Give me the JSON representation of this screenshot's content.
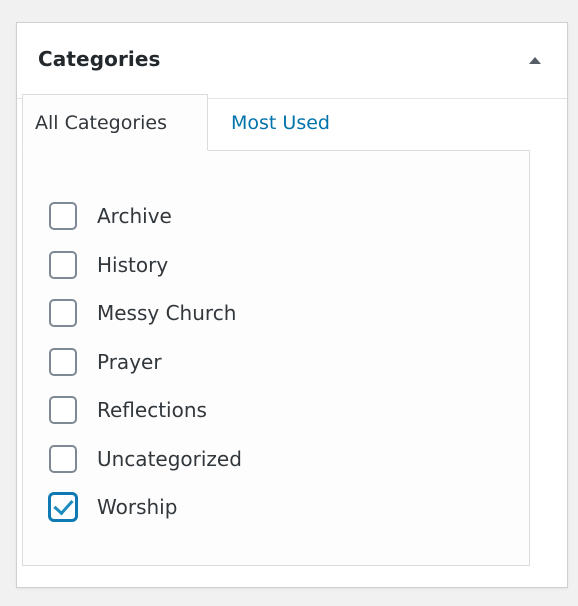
{
  "panel": {
    "title": "Categories",
    "toggle_icon": "triangle-up-icon"
  },
  "tabs": [
    {
      "label": "All Categories",
      "active": true
    },
    {
      "label": "Most Used",
      "active": false
    }
  ],
  "categories": [
    {
      "label": "Archive",
      "checked": false
    },
    {
      "label": "History",
      "checked": false
    },
    {
      "label": "Messy Church",
      "checked": false
    },
    {
      "label": "Prayer",
      "checked": false
    },
    {
      "label": "Reflections",
      "checked": false
    },
    {
      "label": "Uncategorized",
      "checked": false
    },
    {
      "label": "Worship",
      "checked": true
    }
  ],
  "colors": {
    "link": "#0073aa",
    "checked": "#1e8cbe",
    "text": "#32373c",
    "background": "#f1f1f1"
  }
}
